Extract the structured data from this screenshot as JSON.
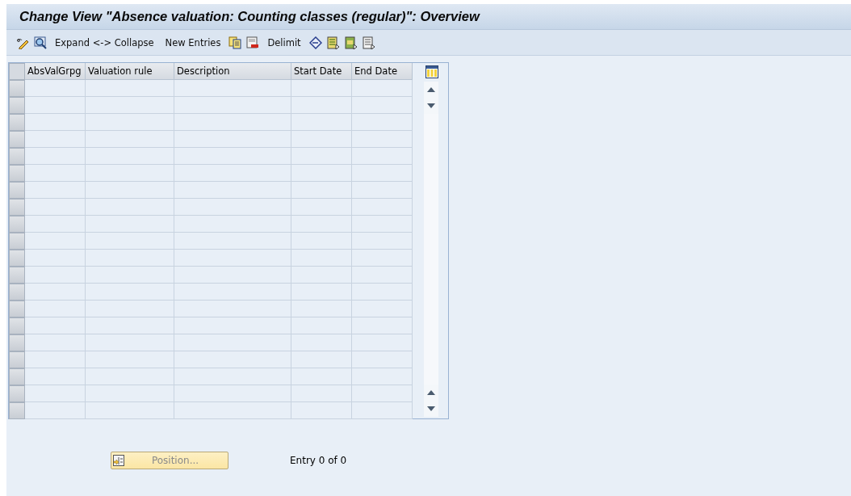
{
  "window": {
    "title": "Change View \"Absence valuation: Counting classes (regular)\": Overview"
  },
  "toolbar": [
    {
      "kind": "icon"
    },
    {
      "kind": "icon"
    },
    {
      "kind": "text",
      "label": "Expand <-> Collapse"
    },
    {
      "kind": "text",
      "label": "New Entries"
    },
    {
      "kind": "icon"
    },
    {
      "kind": "icon"
    },
    {
      "kind": "text",
      "label": "Delimit"
    },
    {
      "kind": "icon"
    },
    {
      "kind": "icon"
    },
    {
      "kind": "icon"
    },
    {
      "kind": "icon"
    }
  ],
  "table": {
    "columns": [
      "AbsValGrpg",
      "Valuation rule",
      "Description",
      "Start Date",
      "End Date"
    ]
  },
  "footer": {
    "position_button": {
      "label": "Position...",
      "disabled": true
    },
    "entry_count": "Entry 0 of 0"
  }
}
